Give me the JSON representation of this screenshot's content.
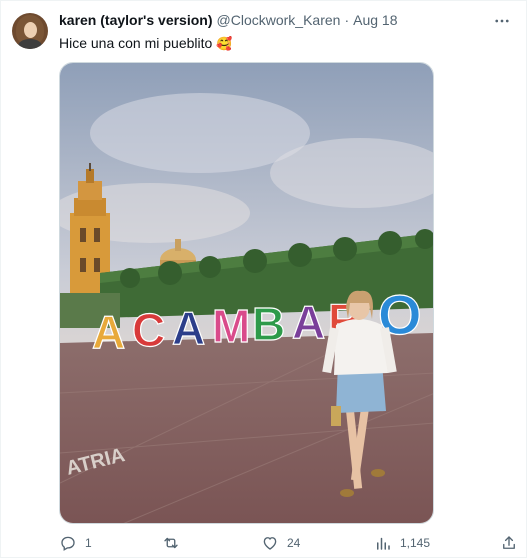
{
  "tweet": {
    "author_name": "karen (taylor's version)",
    "handle": "@Clockwork_Karen",
    "separator": "·",
    "date": "Aug 18",
    "more_icon": "ellipsis-icon",
    "text": "Hice una con mi pueblito",
    "emoji": "🥰",
    "media": {
      "sign_letters": [
        "A",
        "C",
        "A",
        "M",
        "B",
        "A",
        "R",
        "O"
      ],
      "sign_colors": [
        "#e8a93a",
        "#d83a3a",
        "#2c3e8a",
        "#d94b8b",
        "#2e9a4a",
        "#7a3f9a",
        "#e04a3a",
        "#2a8ad8"
      ],
      "pavement_text": "ATRIA"
    },
    "actions": {
      "reply_count": "1",
      "retweet_count": "",
      "like_count": "24",
      "views_count": "1,145",
      "reply_icon": "reply-icon",
      "retweet_icon": "retweet-icon",
      "like_icon": "heart-icon",
      "views_icon": "analytics-icon",
      "share_icon": "share-icon"
    }
  }
}
